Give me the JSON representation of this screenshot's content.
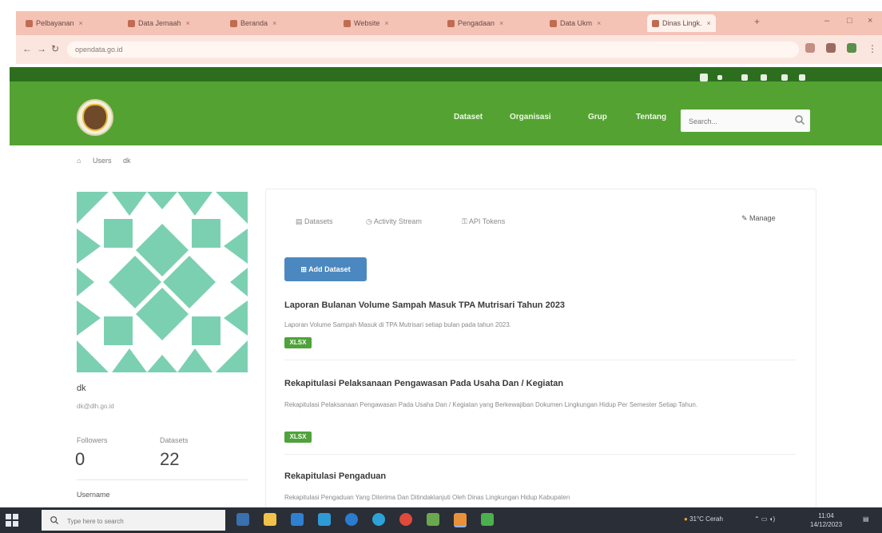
{
  "colors": {
    "site_green": "#54a332",
    "site_dark_green": "#2c6e1e",
    "accent_blue": "#4b88c0",
    "badge_green": "#4ea33a",
    "identicon_teal": "#7cd0b2",
    "tabbar": "#f4c3b5",
    "taskbar": "#2a2e36"
  },
  "browser": {
    "tabs": [
      {
        "label": "Pelbayanan",
        "icon": "page-icon"
      },
      {
        "label": "Data Jemaah",
        "icon": "page-icon"
      },
      {
        "label": "Beranda",
        "icon": "page-icon"
      },
      {
        "label": "Website",
        "icon": "page-icon"
      },
      {
        "label": "Pengadaan",
        "icon": "page-icon"
      },
      {
        "label": "Data Ukm",
        "icon": "page-icon"
      },
      {
        "label": "Dinas Lingk.",
        "icon": "page-icon"
      }
    ],
    "url": "opendata.go.id"
  },
  "site": {
    "nav": [
      "Dataset",
      "Organisasi",
      "Grup",
      "Tentang"
    ],
    "search_placeholder": "Search..."
  },
  "breadcrumb": [
    "Users",
    "dk"
  ],
  "profile": {
    "username": "dk",
    "email": "dk@dlh.go.id",
    "followers_label": "Followers",
    "followers_value": "0",
    "datasets_label": "Datasets",
    "datasets_value": "22",
    "username_label": "Username"
  },
  "tabs": {
    "t1": "Datasets",
    "t2": "Activity Stream",
    "t3": "API Tokens",
    "edit": "Manage"
  },
  "add_button": "Add Dataset",
  "datasets": [
    {
      "title": "Laporan Bulanan Volume Sampah Masuk TPA Mutrisari Tahun 2023",
      "desc": "Laporan Volume Sampah Masuk di TPA Mutrisari setiap bulan pada tahun 2023.",
      "badge": "XLSX"
    },
    {
      "title": "Rekapitulasi Pelaksanaan Pengawasan Pada Usaha Dan / Kegiatan",
      "desc": "Rekapitulasi Pelaksanaan Pengawasan Pada Usaha Dan / Kegiatan yang Berkewajiban Dokumen Lingkungan Hidup Per Semester Setiap Tahun.",
      "badge": "XLSX"
    },
    {
      "title": "Rekapitulasi Pengaduan",
      "desc": "Rekapitulasi Pengaduan Yang Diterima Dan Ditindaklanjuti Oleh Dinas Lingkungan Hidup Kabupaten"
    }
  ],
  "taskbar": {
    "search_placeholder": "Type here to search",
    "weather": "31°C Cerah",
    "time": "11:04",
    "date": "14/12/2023"
  }
}
